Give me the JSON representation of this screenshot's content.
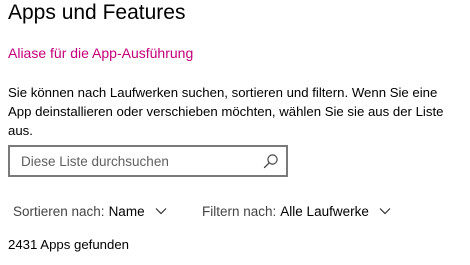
{
  "page": {
    "title": "Apps und Features",
    "alias_link": "Aliase für die App-Ausführung",
    "description": "Sie können nach Laufwerken suchen, sortieren und filtern. Wenn Sie eine App deinstallieren oder verschieben möchten, wählen Sie sie aus der Liste aus."
  },
  "search": {
    "value": "",
    "placeholder": "Diese Liste durchsuchen",
    "icon": "search-icon"
  },
  "sort": {
    "label": "Sortieren nach:",
    "value": "Name",
    "icon": "chevron-down-icon"
  },
  "filter": {
    "label": "Filtern nach:",
    "value": "Alle Laufwerke",
    "icon": "chevron-down-icon"
  },
  "results": {
    "count_text": "2431 Apps gefunden"
  },
  "colors": {
    "link": "#c3007a",
    "border": "#7a7a7a",
    "placeholder": "#5f5f5f"
  }
}
